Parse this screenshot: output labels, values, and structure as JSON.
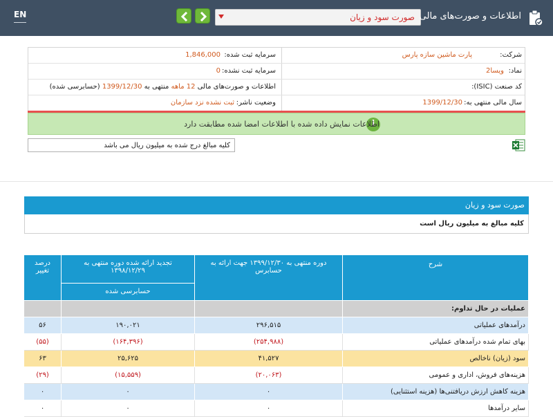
{
  "header": {
    "lang": "EN",
    "title": "اطلاعات و صورت‌های مالی",
    "report_select": "صورت سود و زیان"
  },
  "info": {
    "company_label": "شرکت:",
    "company_value": "پارت ماشین سازه پارس",
    "symbol_label": "نماد:",
    "symbol_value": "ویسا2",
    "isic_label": "کد صنعت (ISIC):",
    "fiscal_label": "سال مالی منتهی به:",
    "fiscal_value": "1399/12/30",
    "registered_capital_label": "سرمایه ثبت شده:",
    "registered_capital_value": "1,846,000",
    "unregistered_capital_label": "سرمایه ثبت نشده:",
    "unregistered_capital_value": "0",
    "statements_prefix": "اطلاعات و صورت‌های مالی",
    "statements_period": "12 ماهه",
    "statements_mid": "منتهی به",
    "statements_date": "1399/12/30",
    "statements_suffix": "(حسابرسی شده)",
    "publisher_label": "وضعیت ناشر:",
    "publisher_value": "ثبت نشده نزد سازمان"
  },
  "message": "اطلاعات نمایش داده شده با اطلاعات امضا شده مطابقت دارد",
  "message_icon": "i",
  "amounts_note": "کلیه مبالغ درج شده به میلیون ریال می باشد",
  "report": {
    "title": "صورت سود و زیان",
    "note": "کلیه مبالغ به میلیون ریال است"
  },
  "table": {
    "col_desc": "شرح",
    "col_current": "دوره منتهی به ۱۳۹۹/۱۲/۳۰ جهت ارائه به حسابرس",
    "col_restated": "تجدید ارائه شده دوره منتهی به ۱۳۹۸/۱۲/۲۹",
    "col_restated_sub": "حسابرسی شده",
    "col_change": "درصد تغییر",
    "section": "عملیات در حال تداوم:",
    "rows": [
      {
        "desc": "درآمدهای عملیاتی",
        "cur": "۲۹۶,۵۱۵",
        "prev": "۱۹۰,۰۲۱",
        "chg": "۵۶"
      },
      {
        "desc": "بهای تمام شده درآمدهای عملیاتی",
        "cur": "(۲۵۴,۹۸۸)",
        "prev": "(۱۶۴,۳۹۶)",
        "chg": "(۵۵)"
      },
      {
        "desc": "سود (زیان) ناخالص",
        "cur": "۴۱,۵۲۷",
        "prev": "۲۵,۶۲۵",
        "chg": "۶۳"
      },
      {
        "desc": "هزینه‌های فروش، اداری و عمومی",
        "cur": "(۲۰,۰۶۳)",
        "prev": "(۱۵,۵۵۹)",
        "chg": "(۲۹)"
      },
      {
        "desc": "هزینه کاهش ارزش دریافتنی‌ها (هزینه استثنایی)",
        "cur": "۰",
        "prev": "۰",
        "chg": "۰"
      },
      {
        "desc": "سایر درآمدها",
        "cur": "۰",
        "prev": "۰",
        "chg": "۰"
      }
    ]
  },
  "colors": {
    "header_bg": "#3f5063",
    "table_header": "#1a9ad0",
    "negative": "#c0161c",
    "gross_row": "#fbe3a0"
  }
}
